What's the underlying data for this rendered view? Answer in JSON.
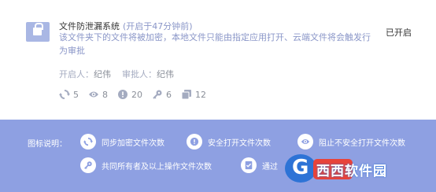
{
  "card": {
    "title": "文件防泄漏系统",
    "title_note": "(开启于47分钟前)",
    "description": "该文件夹下的文件将被加密，本地文件只能由指定应用打开、云端文件将会触发行为审批",
    "status": "已开启",
    "opener_label": "开启人：",
    "opener_name": "纪伟",
    "approver_label": "审批人：",
    "approver_name": "纪伟",
    "stats": [
      {
        "icon": "sync-icon",
        "value": "5"
      },
      {
        "icon": "eye-icon",
        "value": "8"
      },
      {
        "icon": "alert-icon",
        "value": "20"
      },
      {
        "icon": "key-icon",
        "value": "6"
      },
      {
        "icon": "copy-icon",
        "value": "12"
      }
    ]
  },
  "legend": {
    "title": "图标说明：",
    "items": [
      {
        "icon": "sync-icon",
        "label": "同步加密文件次数"
      },
      {
        "icon": "shield-alert-icon",
        "label": "安全打开文件次数"
      },
      {
        "icon": "eye-icon",
        "label": "阻止不安全打开文件次数"
      },
      {
        "icon": "key-icon",
        "label": "共同所有者及以上操作文件次数"
      },
      {
        "icon": "check-doc-icon",
        "label": "通过"
      }
    ]
  },
  "watermark": {
    "text": "西西软件园"
  },
  "colors": {
    "accent": "#8ea0e2",
    "lock": "#a9b7e4",
    "muted_text": "#8a96c8"
  }
}
